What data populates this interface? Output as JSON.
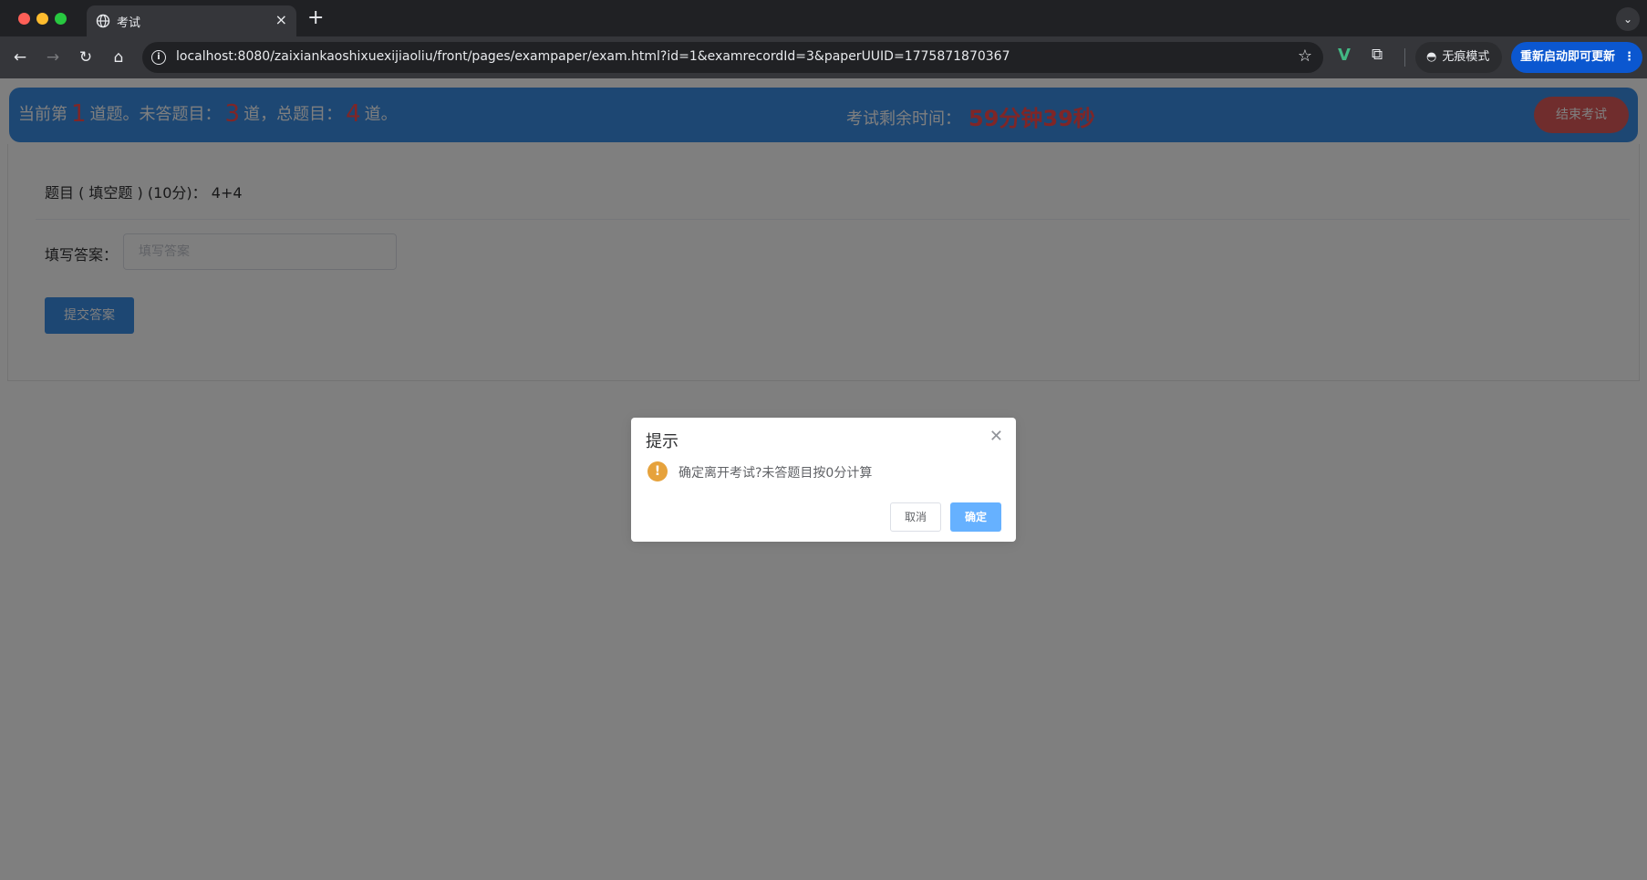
{
  "browser": {
    "tab_title": "考试",
    "tab_close": "×",
    "new_tab": "+",
    "tab_search": "⌄",
    "url": "localhost:8080/zaixiankaoshixuexijiaoliu/front/pages/exampaper/exam.html?id=1&examrecordId=3&paperUUID=1775871870367",
    "incognito_label": "无痕模式",
    "update_label": "重新启动即可更新",
    "ext_v": "V"
  },
  "exam": {
    "progress_prefix": "当前第",
    "current_num": "1",
    "progress_mid1": "道题。未答题目：",
    "unanswered_num": "3",
    "progress_mid2": "道，总题目：",
    "total_num": "4",
    "progress_suffix": "道。",
    "timer_label": "考试剩余时间：",
    "timer_value": "59分钟39秒",
    "end_button": "结束考试"
  },
  "question": {
    "title": "题目 ( 填空题 ) (10分)：  4+4",
    "answer_label": "填写答案：",
    "answer_placeholder": "填写答案",
    "answer_value": "",
    "submit_button": "提交答案"
  },
  "dialog": {
    "title": "提示",
    "message": "确定离开考试?未答题目按0分计算",
    "cancel_button": "取消",
    "ok_button": "确定"
  }
}
